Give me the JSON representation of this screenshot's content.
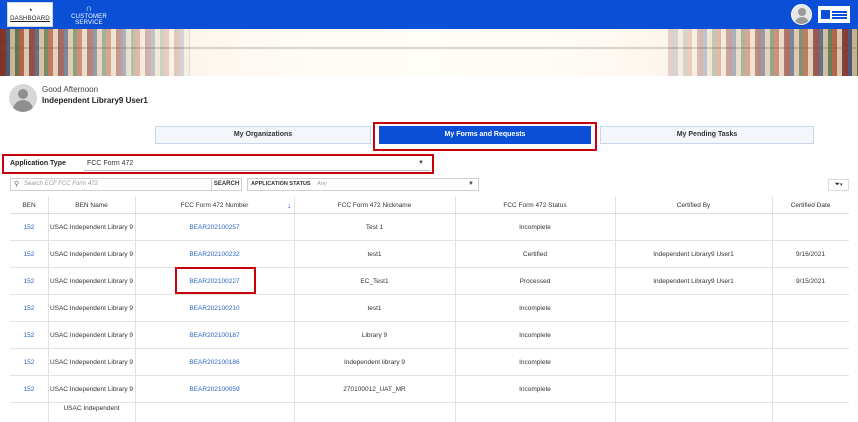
{
  "nav": {
    "dashboard_icon": "speedometer-icon",
    "dashboard_label": "DASHBOARD",
    "customer_service_icon": "headset-icon",
    "customer_service_label": "CUSTOMER SERVICE"
  },
  "user": {
    "greeting": "Good Afternoon",
    "name": "Independent Library9 User1"
  },
  "tabs": [
    {
      "label": "My Organizations",
      "active": false
    },
    {
      "label": "My Forms and Requests",
      "active": true
    },
    {
      "label": "My Pending Tasks",
      "active": false
    }
  ],
  "application_type": {
    "label": "Application Type",
    "value": "FCC Form 472"
  },
  "search": {
    "placeholder": "Search ECF FCC Form 472",
    "button": "SEARCH"
  },
  "status_filter": {
    "label": "APPLICATION STATUS",
    "value": "Any"
  },
  "table": {
    "columns": [
      "BEN",
      "BEN Name",
      "FCC Form 472 Number",
      "FCC Form 472 Nickname",
      "FCC Form 472 Status",
      "Certified By",
      "Certified Date"
    ],
    "rows": [
      {
        "ben": "152",
        "ben_name": "USAC Independent Library 9",
        "number": "BEAR202100257",
        "nickname": "Test 1",
        "status": "Incomplete",
        "certified_by": "",
        "certified_date": ""
      },
      {
        "ben": "152",
        "ben_name": "USAC Independent Library 9",
        "number": "BEAR202100232",
        "nickname": "test1",
        "status": "Certified",
        "certified_by": "Independent Library9 User1",
        "certified_date": "9/16/2021"
      },
      {
        "ben": "152",
        "ben_name": "USAC Independent Library 9",
        "number": "BEAR202100227",
        "nickname": "EC_Test1",
        "status": "Processed",
        "certified_by": "Independent Library9 User1",
        "certified_date": "9/15/2021"
      },
      {
        "ben": "152",
        "ben_name": "USAC Independent Library 9",
        "number": "BEAR202100210",
        "nickname": "test1",
        "status": "Incomplete",
        "certified_by": "",
        "certified_date": ""
      },
      {
        "ben": "152",
        "ben_name": "USAC Independent Library 9",
        "number": "BEAR202100187",
        "nickname": "Library 9",
        "status": "Incomplete",
        "certified_by": "",
        "certified_date": ""
      },
      {
        "ben": "152",
        "ben_name": "USAC Independent Library 9",
        "number": "BEAR202100186",
        "nickname": "Independent library 9",
        "status": "Incomplete",
        "certified_by": "",
        "certified_date": ""
      },
      {
        "ben": "152",
        "ben_name": "USAC Independent Library 9",
        "number": "BEAR202100059",
        "nickname": "270100012_UAT_MR",
        "status": "Incomplete",
        "certified_by": "",
        "certified_date": ""
      },
      {
        "ben": "",
        "ben_name": "USAC Independent",
        "number": "",
        "nickname": "",
        "status": "",
        "certified_by": "",
        "certified_date": ""
      }
    ]
  },
  "colors": {
    "brand_blue": "#0b4fd6",
    "link_blue": "#2a64c4",
    "highlight_red": "#c8000a"
  }
}
